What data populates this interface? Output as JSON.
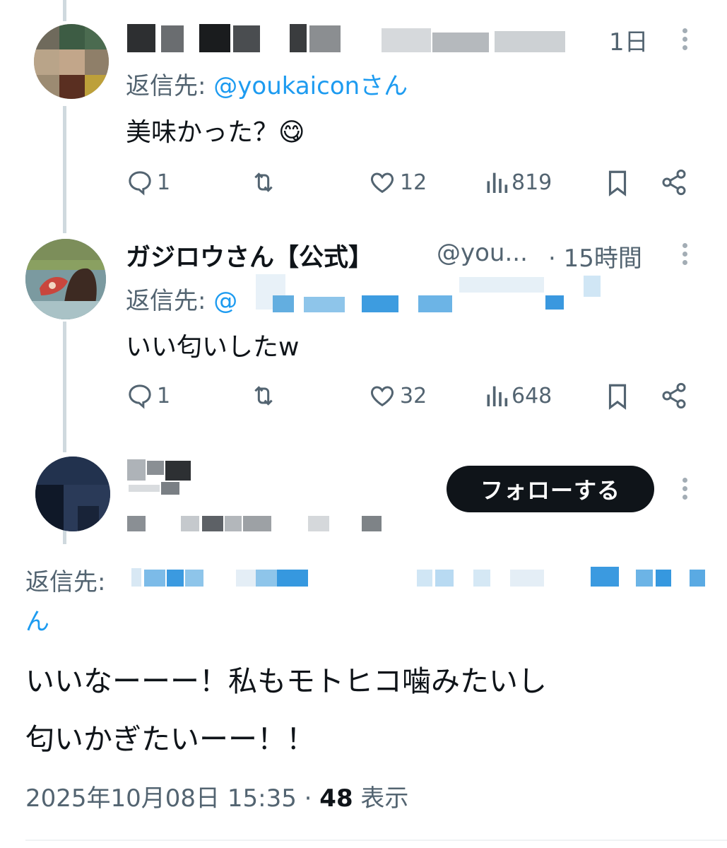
{
  "colors": {
    "accent": "#1d9bf0",
    "text": "#0f1419",
    "muted": "#536471",
    "thread": "#cfd9de",
    "follow_bg": "#0f1419"
  },
  "reply1": {
    "time": "1日",
    "reply_prefix": "返信先:",
    "reply_handle": "@youkaiconさん",
    "text": "美味かった？😋",
    "replies": "1",
    "likes": "12",
    "views": "819"
  },
  "reply2": {
    "name": "ガジロウさん【公式】",
    "handle": "@you...",
    "time": "· 15時間",
    "reply_prefix": "返信先:",
    "reply_handle_start": "@",
    "text": "いい匂いしたw",
    "replies": "1",
    "likes": "32",
    "views": "648"
  },
  "main": {
    "follow_label": "フォローする",
    "reply_prefix": "返信先:",
    "reply_tail": "ん",
    "text_line1": "いいなーーー！私もモトヒコ噛みたいし",
    "text_line2": "匂いかぎたいーー！！",
    "date": "2025年10月08日 15:35 ·",
    "views_count": "48",
    "views_label": "表示"
  },
  "icons": [
    "reply-icon",
    "retweet-icon",
    "like-icon",
    "views-icon",
    "bookmark-icon",
    "share-icon",
    "more-icon"
  ]
}
